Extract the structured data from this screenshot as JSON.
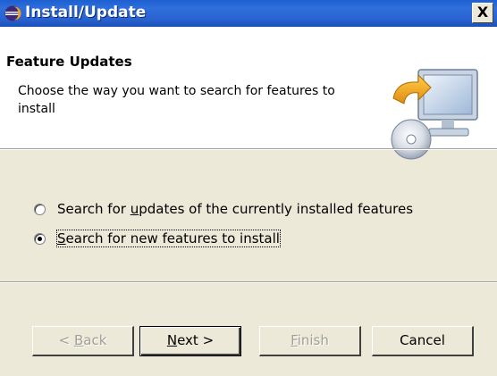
{
  "window": {
    "title": "Install/Update",
    "close_label": "X"
  },
  "header": {
    "title": "Feature Updates",
    "description": "Choose the way you want to search for features to install"
  },
  "options": [
    {
      "pre": "Search for ",
      "accel": "u",
      "post": "pdates of the currently installed features",
      "selected": false
    },
    {
      "pre": "",
      "accel": "S",
      "post": "earch for new features to install",
      "selected": true
    }
  ],
  "buttons": {
    "back": {
      "pre": "< ",
      "accel": "B",
      "post": "ack",
      "enabled": false
    },
    "next": {
      "pre": "",
      "accel": "N",
      "post": "ext >",
      "enabled": true
    },
    "finish": {
      "pre": "",
      "accel": "F",
      "post": "inish",
      "enabled": false
    },
    "cancel": {
      "label": "Cancel",
      "enabled": true
    }
  },
  "icons": [
    "eclipse-app-icon",
    "close-icon",
    "install-update-wizard-graphic"
  ]
}
